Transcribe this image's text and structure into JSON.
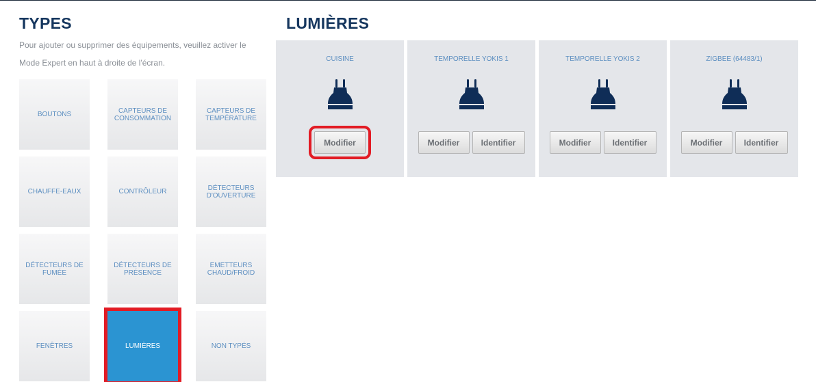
{
  "types": {
    "title": "TYPES",
    "description": "Pour ajouter ou supprimer des équipements, veuillez activer le Mode Expert en haut à droite de l'écran.",
    "tiles": [
      {
        "label": "BOUTONS"
      },
      {
        "label": "CAPTEURS DE CONSOMMATION"
      },
      {
        "label": "CAPTEURS DE TEMPÉRATURE"
      },
      {
        "label": "CHAUFFE-EAUX"
      },
      {
        "label": "CONTRÔLEUR"
      },
      {
        "label": "DÉTECTEURS D'OUVERTURE"
      },
      {
        "label": "DÉTECTEURS DE FUMÉE"
      },
      {
        "label": "DÉTECTEURS DE PRÉSENCE"
      },
      {
        "label": "EMETTEURS CHAUD/FROID"
      },
      {
        "label": "FENÊTRES"
      },
      {
        "label": "LUMIÈRES"
      },
      {
        "label": "NON TYPÉS"
      }
    ],
    "active_tile": "LUMIÈRES"
  },
  "lumieres": {
    "title": "LUMIÈRES",
    "devices": [
      {
        "name": "CUISINE",
        "modify_label": "Modifier",
        "identify_label": null
      },
      {
        "name": "TEMPORELLE YOKIS 1",
        "modify_label": "Modifier",
        "identify_label": "Identifier"
      },
      {
        "name": "TEMPORELLE YOKIS 2",
        "modify_label": "Modifier",
        "identify_label": "Identifier"
      },
      {
        "name": "ZIGBEE (64483/1)",
        "modify_label": "Modifier",
        "identify_label": "Identifier"
      }
    ],
    "device_icon": "light-bulb-icon"
  },
  "colors": {
    "title_blue": "#15365e",
    "tile_text": "#5d8fc1",
    "active_tile": "#2b94d2",
    "highlight_red": "#e21b24",
    "icon_navy": "#0f2d57"
  }
}
